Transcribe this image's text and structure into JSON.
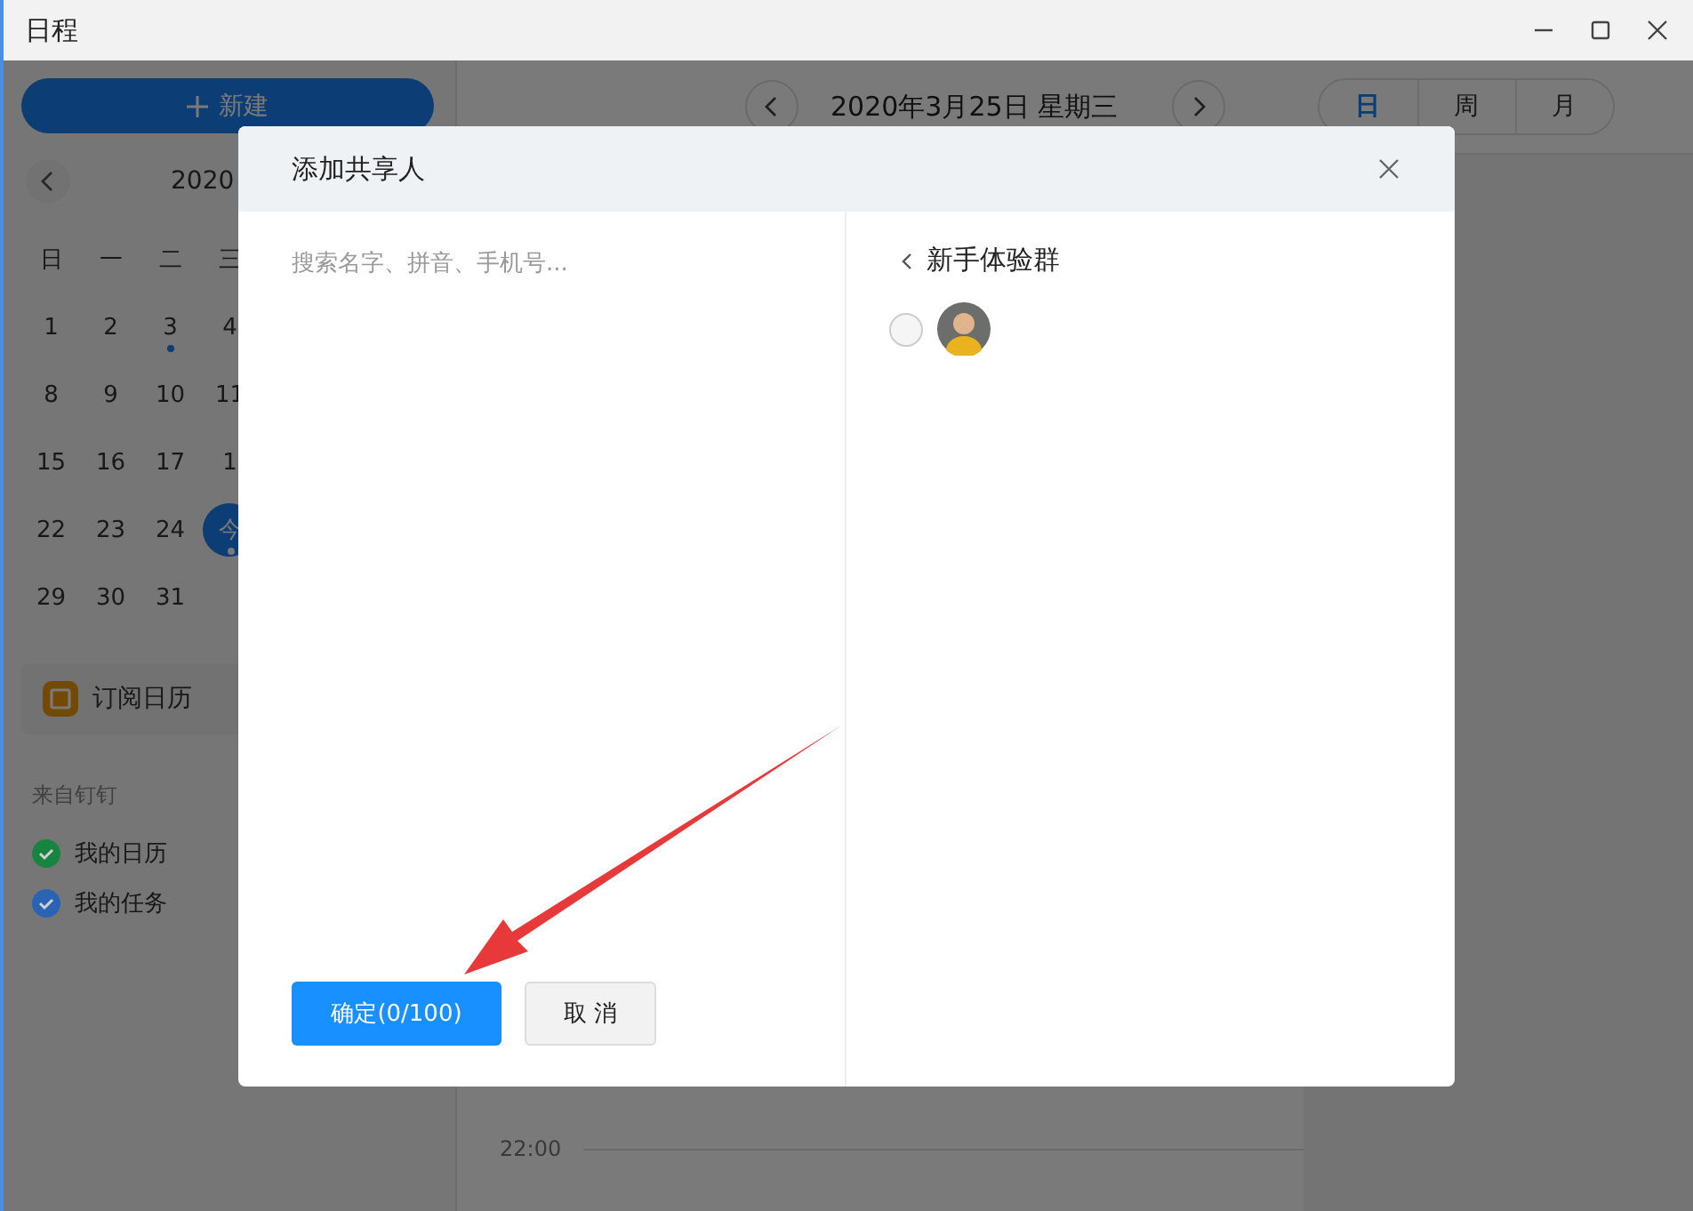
{
  "window": {
    "title": "日程"
  },
  "sidebar": {
    "new_button": "新建",
    "month_title": "2020",
    "weekdays": [
      "日",
      "一",
      "二",
      "三"
    ],
    "weeks": [
      [
        {
          "day": "1",
          "today": false,
          "event": false
        },
        {
          "day": "2",
          "today": false,
          "event": false
        },
        {
          "day": "3",
          "today": false,
          "event": true
        },
        {
          "day": "4",
          "today": false,
          "event": false
        }
      ],
      [
        {
          "day": "8",
          "today": false,
          "event": false
        },
        {
          "day": "9",
          "today": false,
          "event": false
        },
        {
          "day": "10",
          "today": false,
          "event": false
        },
        {
          "day": "11",
          "today": false,
          "event": false
        }
      ],
      [
        {
          "day": "15",
          "today": false,
          "event": false
        },
        {
          "day": "16",
          "today": false,
          "event": false
        },
        {
          "day": "17",
          "today": false,
          "event": false
        },
        {
          "day": "1",
          "today": false,
          "event": false
        }
      ],
      [
        {
          "day": "22",
          "today": false,
          "event": false
        },
        {
          "day": "23",
          "today": false,
          "event": false
        },
        {
          "day": "24",
          "today": false,
          "event": false
        },
        {
          "day": "今",
          "today": true,
          "event": true
        }
      ],
      [
        {
          "day": "29",
          "today": false,
          "event": false
        },
        {
          "day": "30",
          "today": false,
          "event": false
        },
        {
          "day": "31",
          "today": false,
          "event": false
        }
      ]
    ],
    "subscribe": "订阅日历",
    "section_title": "来自钉钉",
    "calendars": [
      {
        "label": "我的日历",
        "checked": true,
        "color": "#17843f"
      },
      {
        "label": "我的任务",
        "checked": true,
        "color": "#2a62b4"
      }
    ]
  },
  "main": {
    "date": "2020年3月25日 星期三",
    "views": [
      {
        "label": "日",
        "selected": true
      },
      {
        "label": "周",
        "selected": false
      },
      {
        "label": "月",
        "selected": false
      }
    ],
    "time_label": "22:00"
  },
  "dialog": {
    "title": "添加共享人",
    "search": {
      "placeholder": "搜索名字、拼音、手机号..."
    },
    "group": "新手体验群",
    "members": [
      {
        "selected": false
      }
    ],
    "confirm": "确定(0/100)",
    "cancel": "取 消"
  }
}
